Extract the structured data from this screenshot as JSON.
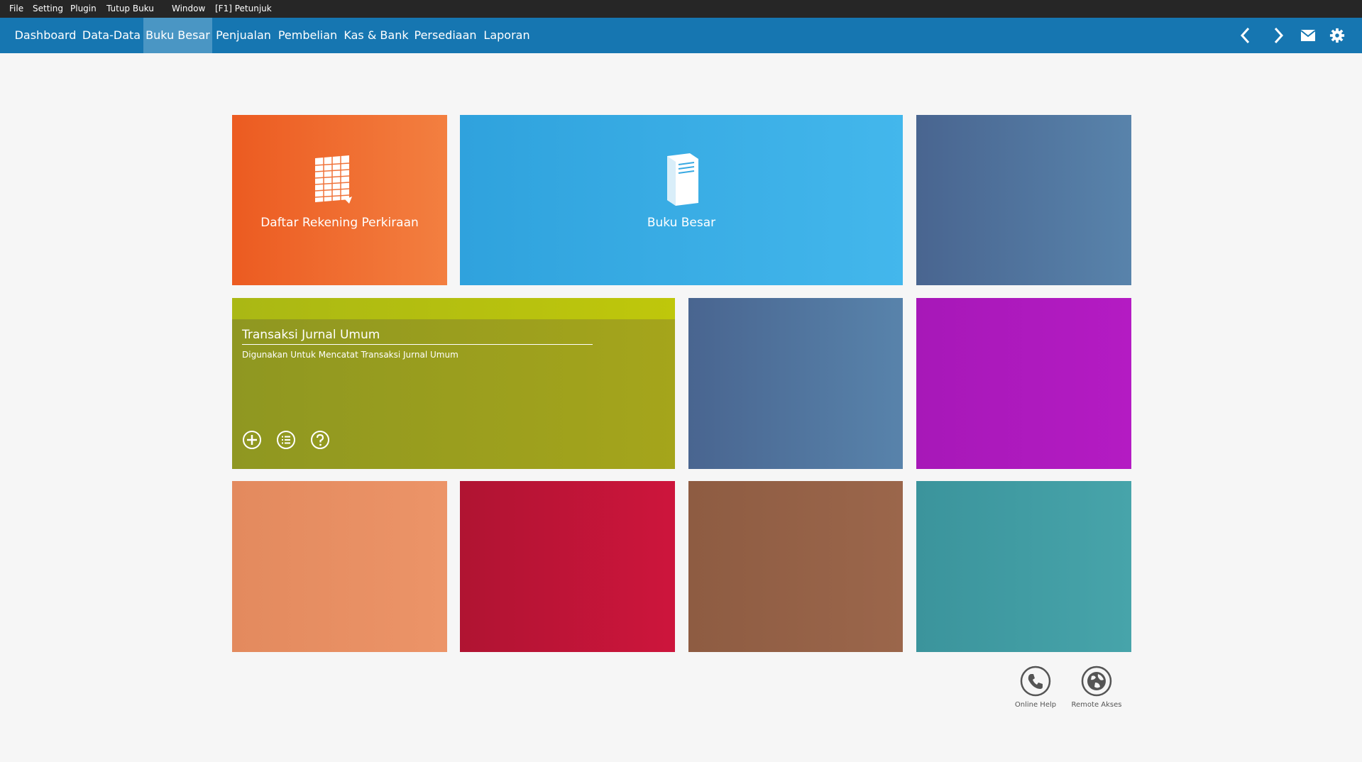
{
  "menubar": {
    "items": [
      "File",
      "Setting",
      "Plugin",
      "Tutup Buku",
      "Window",
      "[F1] Petunjuk"
    ]
  },
  "navbar": {
    "tabs": [
      "Dashboard",
      "Data-Data",
      "Buku Besar",
      "Penjualan",
      "Pembelian",
      "Kas & Bank",
      "Persediaan",
      "Laporan"
    ],
    "active_tab": "Buku Besar",
    "actions": [
      "back-arrow-icon",
      "forward-arrow-icon",
      "mail-icon",
      "gear-icon"
    ]
  },
  "tiles": {
    "daftar_rekening": {
      "label": "Daftar Rekening Perkiraan",
      "icon": "spreadsheet-icon",
      "color": "#ee6125"
    },
    "buku_besar": {
      "label": "Buku Besar",
      "icon": "book-icon",
      "color": "#36a8e3"
    },
    "jurnal": {
      "title": "Transaksi Jurnal Umum",
      "description": "Digunakan Untuk Mencatat Transaksi Jurnal Umum",
      "buttons": [
        "add-circle-icon",
        "list-circle-icon",
        "help-circle-icon"
      ],
      "color": "#9aa11c"
    },
    "blank_colors": [
      "#4c6a94",
      "#4c6a94",
      "#ae18bd",
      "#e38b5f",
      "#c21538",
      "#955f45",
      "#3f9aa2"
    ]
  },
  "bottom_buttons": {
    "online_help": {
      "label": "Online Help",
      "icon": "phone-icon"
    },
    "remote_akses": {
      "label": "Remote Akses",
      "icon": "globe-icon"
    }
  },
  "colors": {
    "menubar_bg": "#262626",
    "navbar_bg": "#1676b1",
    "active_tab_bg": "#4a96c4",
    "page_bg": "#f6f6f6"
  }
}
